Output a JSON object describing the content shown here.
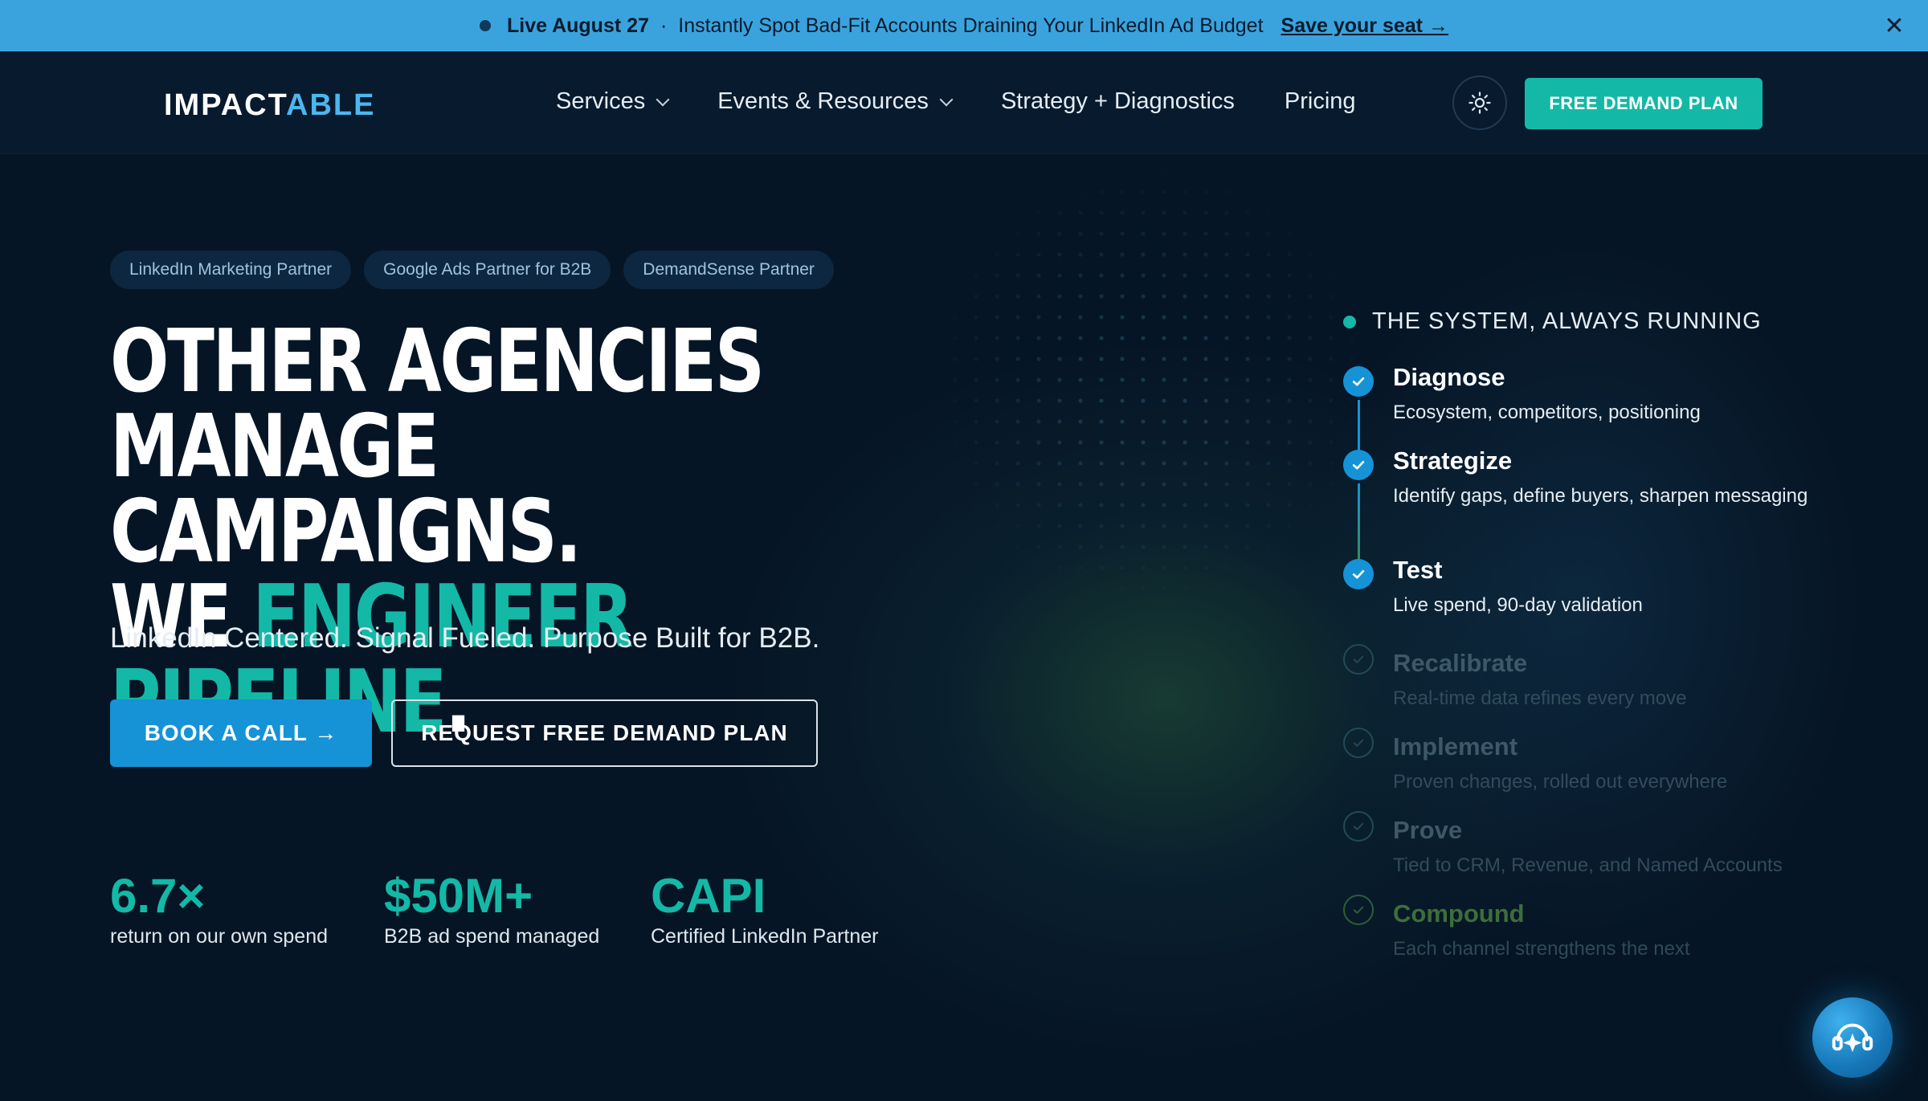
{
  "announcement": {
    "highlight": "Live August 27",
    "separator": "·",
    "text": "Instantly Spot Bad-Fit Accounts Draining Your LinkedIn Ad Budget",
    "link": "Save your seat →",
    "close": "✕"
  },
  "nav": {
    "logo": {
      "part1": "IMPACT",
      "part2": "ABLE"
    },
    "links": [
      {
        "label": "Services",
        "has_dropdown": true
      },
      {
        "label": "Events & Resources",
        "has_dropdown": true
      },
      {
        "label": "Strategy + Diagnostics",
        "has_dropdown": false
      },
      {
        "label": "Pricing",
        "has_dropdown": false
      }
    ],
    "theme_icon": "sun-icon",
    "cta": "FREE DEMAND PLAN"
  },
  "hero": {
    "badges": [
      "LinkedIn Marketing Partner",
      "Google Ads Partner for B2B",
      "DemandSense Partner"
    ],
    "headline": {
      "line1": "OTHER AGENCIES MANAGE",
      "line2": "CAMPAIGNS.",
      "line3_prefix": "WE ",
      "line3_accent": "ENGINEER PIPELINE",
      "line3_suffix": "."
    },
    "subhead": "LinkedIn Centered. Signal Fueled. Purpose Built for B2B.",
    "primary_button": "BOOK A CALL →",
    "secondary_button": "REQUEST FREE DEMAND PLAN",
    "stats": [
      {
        "value": "6.7×",
        "label": "return on our own spend"
      },
      {
        "value": "$50M+",
        "label": "B2B ad spend managed"
      },
      {
        "value": "CAPI",
        "label": "Certified LinkedIn Partner"
      }
    ]
  },
  "system": {
    "title": "THE SYSTEM, ALWAYS RUNNING",
    "steps": [
      {
        "name": "Diagnose",
        "desc": "Ecosystem, competitors, positioning",
        "state": "active"
      },
      {
        "name": "Strategize",
        "desc": "Identify gaps, define buyers, sharpen messaging",
        "state": "active"
      },
      {
        "name": "Test",
        "desc": "Live spend, 90-day validation",
        "state": "active"
      },
      {
        "name": "Recalibrate",
        "desc": "Real-time data refines every move",
        "state": "dim"
      },
      {
        "name": "Implement",
        "desc": "Proven changes, rolled out everywhere",
        "state": "dim"
      },
      {
        "name": "Prove",
        "desc": "Tied to CRM, Revenue, and Named Accounts",
        "state": "dim"
      },
      {
        "name": "Compound",
        "desc": "Each channel strengthens the next",
        "state": "dim-green"
      }
    ]
  },
  "colors": {
    "background": "#061525",
    "announcement_bg": "#3aa3de",
    "teal_accent": "#14b8a6",
    "blue_accent": "#1593d6"
  },
  "chat_widget": {
    "icon": "chat-assistant-icon"
  }
}
